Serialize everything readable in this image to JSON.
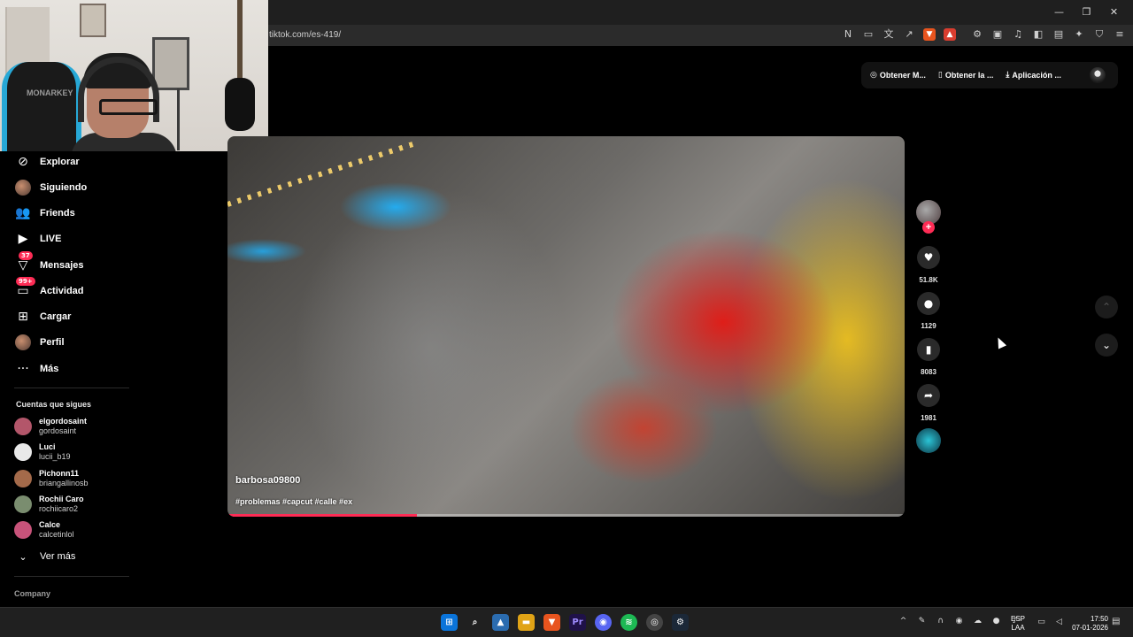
{
  "browser": {
    "url": "tiktok.com/es-419/",
    "window_controls": [
      "—",
      "❐",
      "✕"
    ]
  },
  "webcam": {
    "chair_brand": "MONARKEY"
  },
  "header": {
    "buttons": [
      {
        "icon": "coin-icon",
        "label": "Obtener M..."
      },
      {
        "icon": "phone-icon",
        "label": "Obtener la ..."
      },
      {
        "icon": "download-icon",
        "label": "Aplicación ..."
      }
    ]
  },
  "sidebar": {
    "items": [
      {
        "name": "explorar",
        "label": "Explorar",
        "icon": "compass-icon"
      },
      {
        "name": "siguiendo",
        "label": "Siguiendo",
        "icon": "avatar"
      },
      {
        "name": "friends",
        "label": "Friends",
        "icon": "friends-icon"
      },
      {
        "name": "live",
        "label": "LIVE",
        "icon": "live-icon"
      },
      {
        "name": "mensajes",
        "label": "Mensajes",
        "icon": "message-icon",
        "badge": "37"
      },
      {
        "name": "actividad",
        "label": "Actividad",
        "icon": "activity-icon",
        "badge": "99+"
      },
      {
        "name": "cargar",
        "label": "Cargar",
        "icon": "upload-icon"
      },
      {
        "name": "perfil",
        "label": "Perfil",
        "icon": "avatar"
      },
      {
        "name": "mas",
        "label": "Más",
        "icon": "more-icon"
      }
    ],
    "following_title": "Cuentas que sigues",
    "following": [
      {
        "name": "elgordosaint",
        "handle": "gordosaint",
        "color": "#b3566a"
      },
      {
        "name": "Luci",
        "handle": "lucii_b19",
        "color": "#e9e9e9"
      },
      {
        "name": "Pichonn11",
        "handle": "briangallinosb",
        "color": "#a46a4a"
      },
      {
        "name": "Rochii Caro",
        "handle": "rochiicaro2",
        "color": "#7a8d6f"
      },
      {
        "name": "Calce",
        "handle": "calcetinlol",
        "color": "#c8537a"
      }
    ],
    "see_more": "Ver más",
    "company": "Company"
  },
  "video": {
    "username": "barbosa09800",
    "hashtags": "#problemas #capcut #calle #ex",
    "progress_pct": 28
  },
  "actions": {
    "likes": "51.8K",
    "comments": "1129",
    "saves": "8083",
    "shares": "1981"
  },
  "taskbar": {
    "lang_line1": "ESP",
    "lang_line2": "LAA",
    "time": "17:50",
    "date": "07-01-2026"
  },
  "colors": {
    "accent": "#fe2c55"
  }
}
